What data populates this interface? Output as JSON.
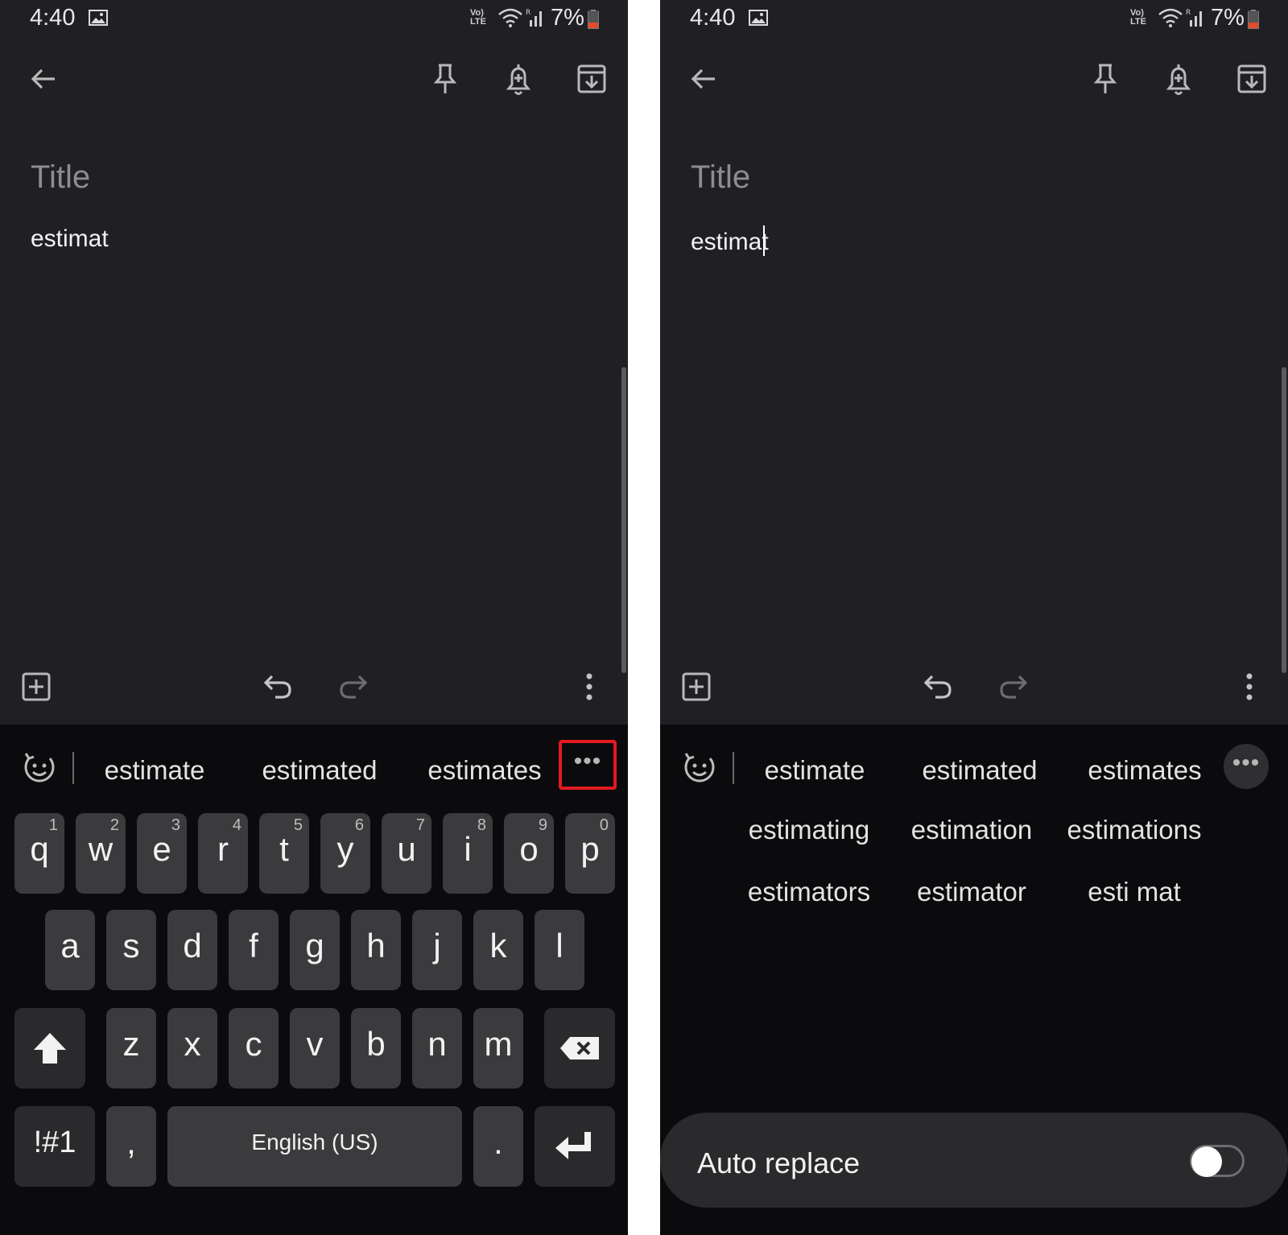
{
  "status": {
    "time": "4:40",
    "lte_top": "Vo)",
    "lte_bottom": "LTE",
    "sig_r": "R",
    "battery": "7%"
  },
  "note": {
    "title_placeholder": "Title",
    "body_text": "estimat"
  },
  "suggestions": [
    "estimate",
    "estimated",
    "estimates"
  ],
  "more_label": "•••",
  "extended_suggestions": [
    [
      "estimating",
      "estimation",
      "estimations"
    ],
    [
      "estimators",
      "estimator",
      "esti mat"
    ]
  ],
  "keyboard": {
    "row1": [
      {
        "k": "q",
        "n": "1"
      },
      {
        "k": "w",
        "n": "2"
      },
      {
        "k": "e",
        "n": "3"
      },
      {
        "k": "r",
        "n": "4"
      },
      {
        "k": "t",
        "n": "5"
      },
      {
        "k": "y",
        "n": "6"
      },
      {
        "k": "u",
        "n": "7"
      },
      {
        "k": "i",
        "n": "8"
      },
      {
        "k": "o",
        "n": "9"
      },
      {
        "k": "p",
        "n": "0"
      }
    ],
    "row2": [
      "a",
      "s",
      "d",
      "f",
      "g",
      "h",
      "j",
      "k",
      "l"
    ],
    "row3": [
      "z",
      "x",
      "c",
      "v",
      "b",
      "n",
      "m"
    ],
    "symbols": "!#1",
    "comma": ",",
    "space": "English (US)",
    "period": "."
  },
  "auto_replace": {
    "label": "Auto replace",
    "enabled": false
  },
  "colors": {
    "highlight": "#e3191f",
    "note_bg": "#202024",
    "keyboard_bg": "#0b0b0d",
    "key_bg": "#3b3b3d"
  },
  "icons": [
    "image-icon",
    "wifi-icon",
    "signal-icon",
    "battery-icon",
    "back-arrow-icon",
    "pin-icon",
    "reminder-bell-icon",
    "archive-icon",
    "add-box-icon",
    "undo-icon",
    "redo-icon",
    "more-vert-icon",
    "emoji-icon",
    "more-dots-icon",
    "shift-icon",
    "backspace-icon",
    "enter-icon"
  ]
}
